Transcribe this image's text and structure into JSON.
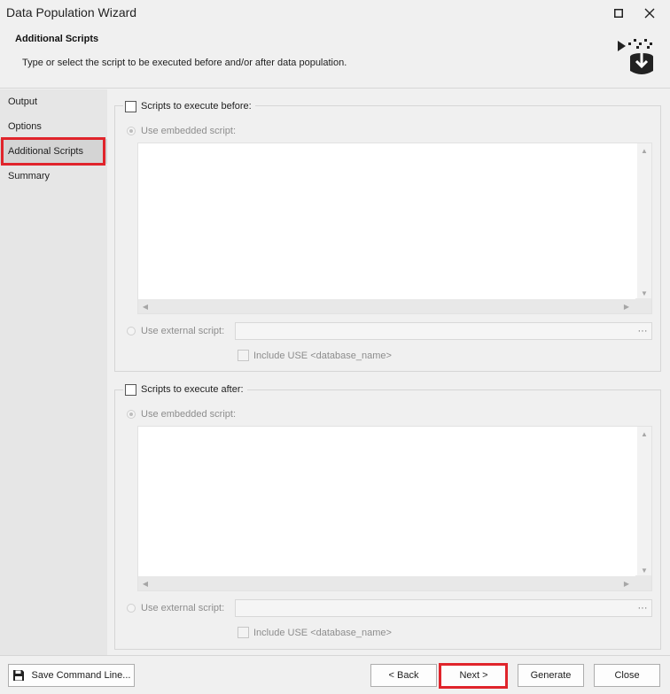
{
  "window": {
    "title": "Data Population Wizard"
  },
  "header": {
    "title": "Additional Scripts",
    "description": "Type or select the script to be executed before and/or after data population."
  },
  "sidebar": {
    "items": [
      {
        "label": "Output"
      },
      {
        "label": "Options"
      },
      {
        "label": "Additional Scripts",
        "active": true
      },
      {
        "label": "Summary"
      }
    ]
  },
  "before": {
    "checkbox_label": "Scripts to execute before:",
    "embedded_label": "Use embedded script:",
    "external_label": "Use external script:",
    "external_value": "",
    "browse_label": "···",
    "include_use_label": "Include USE <database_name>"
  },
  "after": {
    "checkbox_label": "Scripts to execute after:",
    "embedded_label": "Use embedded script:",
    "external_label": "Use external script:",
    "external_value": "",
    "browse_label": "···",
    "include_use_label": "Include USE <database_name>"
  },
  "footer": {
    "save_label": "Save Command Line...",
    "back_label": "< Back",
    "next_label": "Next >",
    "generate_label": "Generate",
    "close_label": "Close"
  },
  "colors": {
    "highlight": "#e0242b",
    "background": "#f0f0f0",
    "sidebar": "#e6e6e6"
  }
}
